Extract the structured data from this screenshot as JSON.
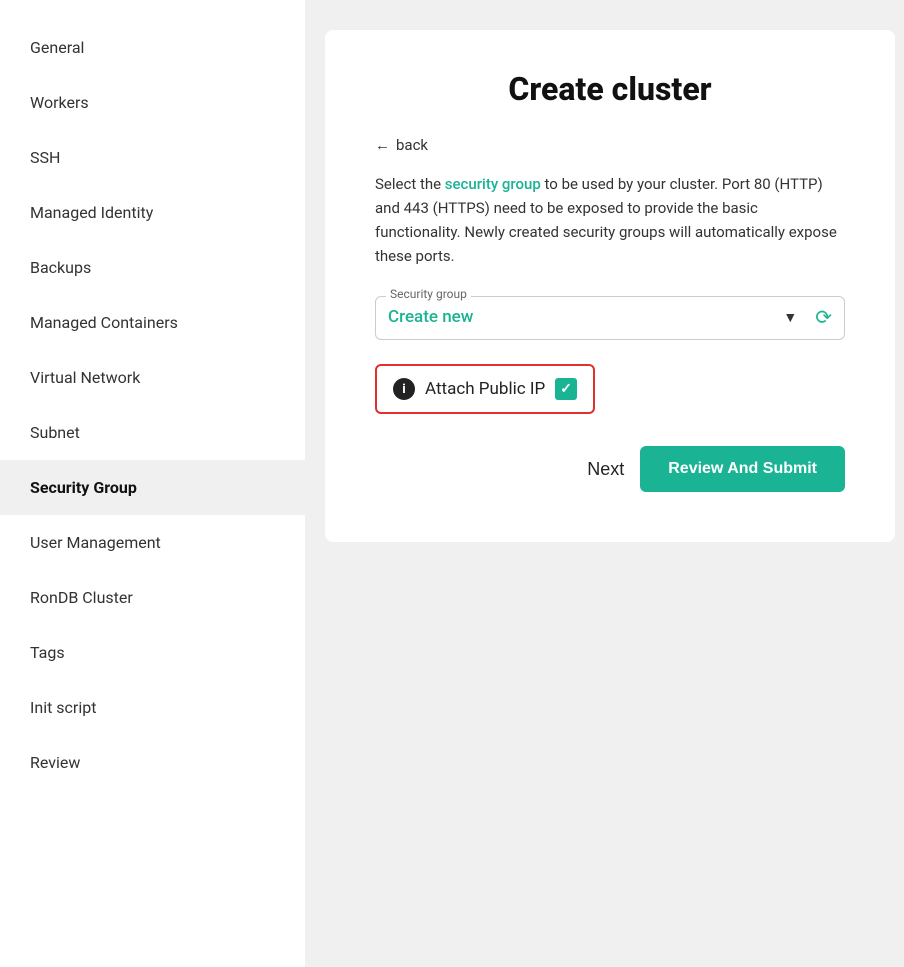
{
  "sidebar": {
    "items": [
      {
        "id": "general",
        "label": "General",
        "active": false
      },
      {
        "id": "workers",
        "label": "Workers",
        "active": false
      },
      {
        "id": "ssh",
        "label": "SSH",
        "active": false
      },
      {
        "id": "managed-identity",
        "label": "Managed Identity",
        "active": false
      },
      {
        "id": "backups",
        "label": "Backups",
        "active": false
      },
      {
        "id": "managed-containers",
        "label": "Managed Containers",
        "active": false
      },
      {
        "id": "virtual-network",
        "label": "Virtual Network",
        "active": false
      },
      {
        "id": "subnet",
        "label": "Subnet",
        "active": false
      },
      {
        "id": "security-group",
        "label": "Security Group",
        "active": true
      },
      {
        "id": "user-management",
        "label": "User Management",
        "active": false
      },
      {
        "id": "rondb-cluster",
        "label": "RonDB Cluster",
        "active": false
      },
      {
        "id": "tags",
        "label": "Tags",
        "active": false
      },
      {
        "id": "init-script",
        "label": "Init script",
        "active": false
      },
      {
        "id": "review",
        "label": "Review",
        "active": false
      }
    ]
  },
  "main": {
    "page_title": "Create cluster",
    "back_label": "back",
    "description_part1": "Select the ",
    "description_highlight": "security group",
    "description_part2": " to be used by your cluster. Port 80 (HTTP) and 443 (HTTPS) need to be exposed to provide the basic functionality. Newly created security groups will automatically expose these ports.",
    "security_group_label": "Security group",
    "security_group_value": "Create new",
    "attach_ip_label": "Attach Public IP",
    "next_label": "Next",
    "review_submit_label": "Review And Submit"
  },
  "colors": {
    "accent": "#1ab394",
    "danger": "#e03030"
  }
}
